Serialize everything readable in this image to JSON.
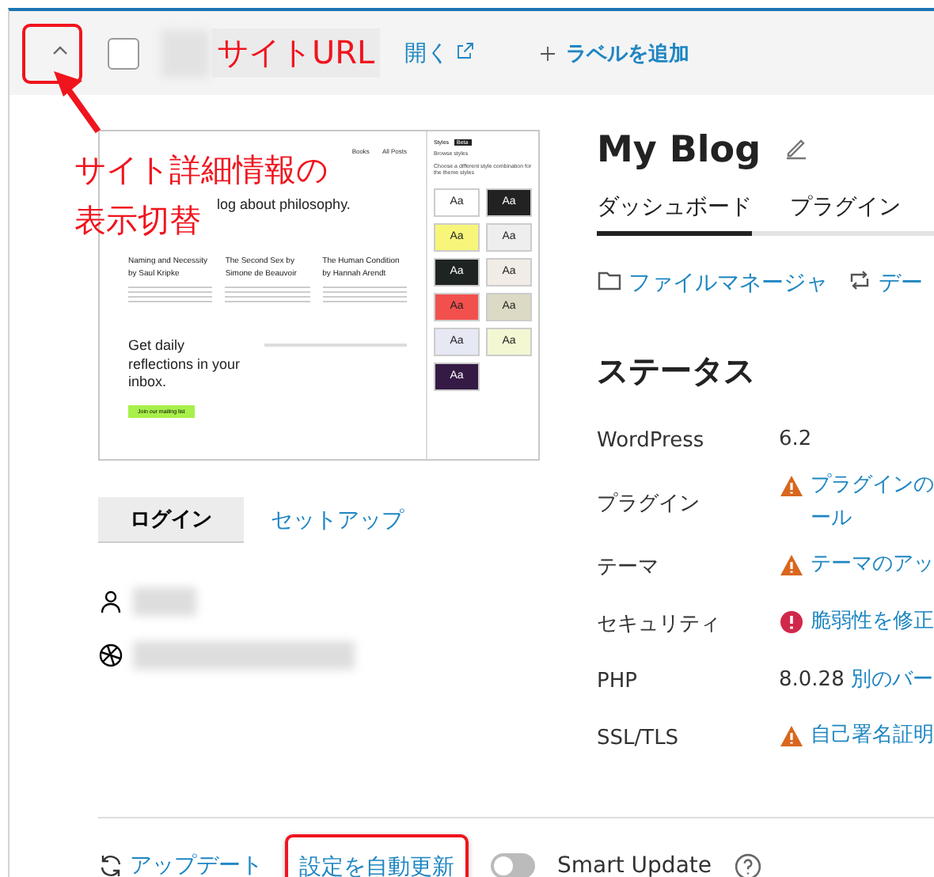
{
  "header": {
    "expanded": true,
    "checked": false,
    "open_link": "開く",
    "add_label": "ラベルを追加"
  },
  "annotations": {
    "url_label": "サイトURL",
    "toggle_note": [
      "サイト詳細情報の",
      "表示切替"
    ]
  },
  "preview": {
    "nav": [
      "Books",
      "All Posts"
    ],
    "headline": "log about philosophy.",
    "posts": [
      {
        "title": "Naming and Necessity by Saul Kripke"
      },
      {
        "title": "The Second Sex by Simone de Beauvoir"
      },
      {
        "title": "The Human Condition by Hannah Arendt"
      }
    ],
    "cta": "Get daily reflections in your inbox.",
    "cta_button": "Join our mailing list",
    "panel": {
      "title": "Styles",
      "badge": "Beta",
      "heading": "Browse styles",
      "description": "Choose a different style combination for the theme styles",
      "tiles": [
        {
          "text": "Aa",
          "color": "#ffffff"
        },
        {
          "text": "Aa",
          "color": "#222222"
        },
        {
          "text": "Aa",
          "color": "#f8f67a"
        },
        {
          "text": "Aa",
          "color": "#eeeeee"
        },
        {
          "text": "Aa",
          "color": "#1d2421"
        },
        {
          "text": "Aa",
          "color": "#f1ede6"
        },
        {
          "text": "Aa",
          "color": "#f2504d"
        },
        {
          "text": "Aa",
          "color": "#dcdac4"
        },
        {
          "text": "Aa",
          "color": "#e6e8f4"
        },
        {
          "text": "Aa",
          "color": "#f3f7d2"
        },
        {
          "text": "Aa",
          "color": "#351a45"
        }
      ]
    }
  },
  "actions": {
    "login": "ログイン",
    "setup": "セットアップ"
  },
  "site": {
    "title": "My Blog",
    "tabs": [
      {
        "label": "ダッシュボード",
        "selected": true
      },
      {
        "label": "プラグイン",
        "selected": false
      }
    ],
    "tools": [
      {
        "kind": "folder",
        "label": "ファイルマネージャ"
      },
      {
        "kind": "sync",
        "label": "デー"
      }
    ]
  },
  "status": {
    "heading": "ステータス",
    "rows": [
      {
        "label": "WordPress",
        "kind": "plain",
        "value": "6.2"
      },
      {
        "label": "プラグイン",
        "kind": "warning",
        "link": [
          "プラグインの",
          "ール"
        ]
      },
      {
        "label": "テーマ",
        "kind": "warning",
        "link": [
          "テーマのアッ"
        ]
      },
      {
        "label": "セキュリティ",
        "kind": "error",
        "link": [
          "脆弱性を修正"
        ]
      },
      {
        "label": "PHP",
        "kind": "plain",
        "value": "8.0.28",
        "link": [
          "別のバー"
        ]
      },
      {
        "label": "SSL/TLS",
        "kind": "warning",
        "link": [
          "自己署名証明"
        ]
      }
    ]
  },
  "footer": {
    "update": "アップデート",
    "auto_update": "設定を自動更新",
    "smart_update": {
      "label": "Smart Update",
      "on": false
    }
  }
}
